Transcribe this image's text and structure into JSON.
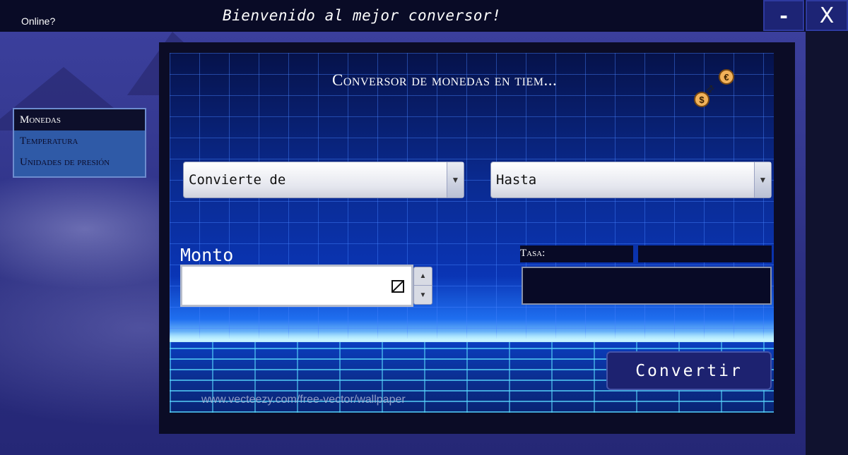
{
  "titlebar": {
    "status_label": "Online?",
    "welcome_text": "Bienvenido al mejor conversor!",
    "minimize_label": "-",
    "close_label": "X"
  },
  "sidebar": {
    "items": [
      {
        "label": "Monedas",
        "active": true
      },
      {
        "label": "Temperatura",
        "active": false
      },
      {
        "label": "Unidades de presión",
        "active": false
      }
    ]
  },
  "main": {
    "title": "Conversor de monedas en tiem...",
    "icons": {
      "euro_coin": "€",
      "dollar_coin": "$",
      "swap_arrow": "⇄"
    },
    "from_select": {
      "value": "Convierte de",
      "arrow": "▼"
    },
    "to_select": {
      "value": "Hasta",
      "arrow": "▼"
    },
    "amount": {
      "label": "Monto",
      "value": "",
      "step_up": "▲",
      "step_down": "▼"
    },
    "rate": {
      "label": "Tasa:",
      "value": ""
    },
    "result": {
      "value": ""
    },
    "convert_button": "Convertir",
    "watermark": "www.vecteezy.com/free-vector/wallpaper"
  },
  "colors": {
    "titlebar_bg": "#090b26",
    "window_button_bg": "#1d2475",
    "sidebar_bg": "#2f5aa7",
    "sidebar_active_bg": "#0d0f2b",
    "convert_button_bg": "#1d2270"
  }
}
